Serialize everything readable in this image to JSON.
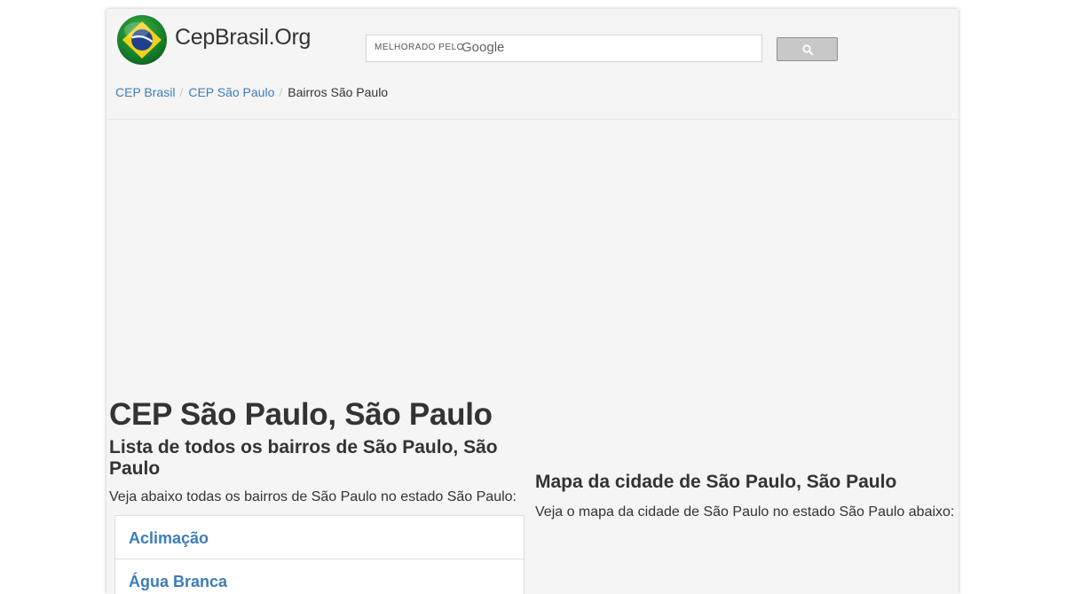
{
  "header": {
    "brand": "CepBrasil.Org",
    "search": {
      "powered_by": "MELHORADO PELO",
      "provider": "Google"
    }
  },
  "breadcrumb": [
    {
      "label": "CEP Brasil"
    },
    {
      "label": "CEP São Paulo"
    },
    {
      "label": "Bairros São Paulo"
    }
  ],
  "main": {
    "title": "CEP São Paulo, São Paulo",
    "subtitle": "Lista de todos os bairros de São Paulo, São Paulo",
    "intro": "Veja abaixo todas os bairros de São Paulo no estado São Paulo:",
    "neighborhoods": [
      {
        "label": "Aclimação"
      },
      {
        "label": "Água Branca"
      }
    ]
  },
  "map": {
    "title": "Mapa da cidade de São Paulo, São Paulo",
    "description": "Veja o mapa da cidade de São Paulo no estado São Paulo abaixo:"
  },
  "colors": {
    "link": "#3e7cb9",
    "text": "#333333",
    "page_background": "#f5f5f5"
  },
  "icons": {
    "logo": "brazil-flag-globe-icon",
    "search_button": "search-icon"
  }
}
